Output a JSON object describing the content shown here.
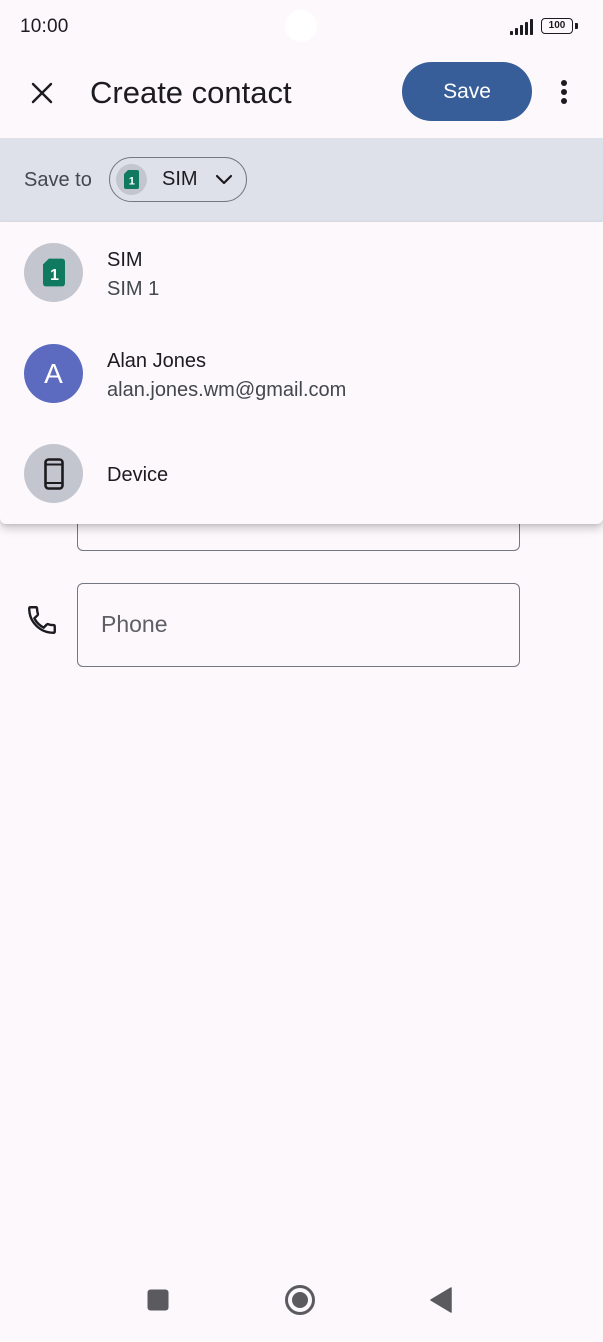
{
  "status_bar": {
    "time": "10:00",
    "battery_level": "100",
    "icons": [
      "signal-icon",
      "battery-icon"
    ]
  },
  "app_bar": {
    "close_icon": "close-icon",
    "title": "Create contact",
    "save_label": "Save",
    "more_icon": "more-vert-icon"
  },
  "save_to": {
    "label": "Save to",
    "selected_account": "SIM",
    "selected_icon": "sim-card-icon",
    "chevron_icon": "chevron-down-icon"
  },
  "account_menu": {
    "items": [
      {
        "title": "SIM",
        "subtitle": "SIM 1",
        "icon": "sim-card-icon"
      },
      {
        "title": "Alan Jones",
        "subtitle": "alan.jones.wm@gmail.com",
        "avatar_letter": "A",
        "avatar_color": "#5c6bc0"
      },
      {
        "title": "Device",
        "subtitle": "",
        "icon": "phone-device-icon"
      }
    ]
  },
  "form": {
    "phone_placeholder": "Phone",
    "phone_icon": "phone-icon"
  },
  "nav_bar": {
    "icons": [
      "recents-icon",
      "home-icon",
      "back-icon"
    ]
  },
  "colors": {
    "primary": "#375e99",
    "background": "#fcf8fc",
    "save_to_bar": "#dfe1ea",
    "sim_green": "#0f7a5f"
  }
}
